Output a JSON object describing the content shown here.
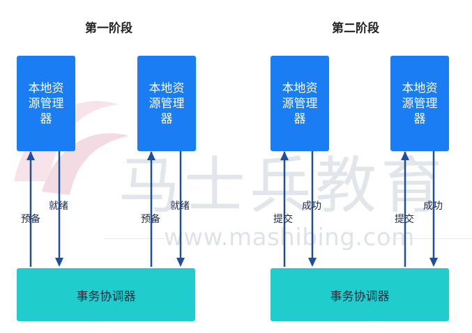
{
  "watermark": {
    "chinese": "马士兵教育",
    "url": "www.mashibing.com"
  },
  "phases": [
    {
      "title": "第一阶段",
      "resource_managers": [
        {
          "label": "本地资源管理器",
          "up_label": "预备",
          "down_label": "就绪"
        },
        {
          "label": "本地资源管理器",
          "up_label": "预备",
          "down_label": "就绪"
        }
      ],
      "coordinator": "事务协调器"
    },
    {
      "title": "第二阶段",
      "resource_managers": [
        {
          "label": "本地资源管理器",
          "up_label": "提交",
          "down_label": "成功"
        },
        {
          "label": "本地资源管理器",
          "up_label": "提交",
          "down_label": "成功"
        }
      ],
      "coordinator": "事务协调器"
    }
  ],
  "colors": {
    "resource_manager": "#1a7df3",
    "coordinator": "#21cccc",
    "arrow": "#1f4e9c"
  }
}
